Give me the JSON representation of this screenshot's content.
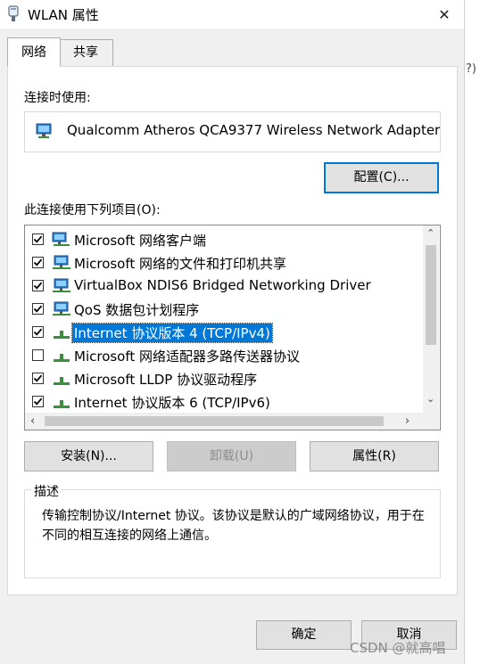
{
  "window": {
    "title": "WLAN 属性",
    "close_glyph": "✕"
  },
  "tabs": [
    {
      "label": "网络",
      "active": true
    },
    {
      "label": "共享",
      "active": false
    }
  ],
  "connect_using": {
    "label": "连接时使用:",
    "adapter_name": "Qualcomm Atheros QCA9377 Wireless Network Adapter",
    "configure_button": "配置(C)..."
  },
  "items_section": {
    "label": "此连接使用下列项目(O):",
    "items": [
      {
        "label": "Microsoft 网络客户端",
        "checked": true,
        "icon": "network-client-icon"
      },
      {
        "label": "Microsoft 网络的文件和打印机共享",
        "checked": true,
        "icon": "network-service-icon"
      },
      {
        "label": "VirtualBox NDIS6 Bridged Networking Driver",
        "checked": true,
        "icon": "network-service-icon"
      },
      {
        "label": "QoS 数据包计划程序",
        "checked": true,
        "icon": "network-service-icon"
      },
      {
        "label": "Internet 协议版本 4 (TCP/IPv4)",
        "checked": true,
        "selected": true,
        "icon": "protocol-icon"
      },
      {
        "label": "Microsoft 网络适配器多路传送器协议",
        "checked": false,
        "icon": "protocol-icon"
      },
      {
        "label": "Microsoft LLDP 协议驱动程序",
        "checked": true,
        "icon": "protocol-icon"
      },
      {
        "label": "Internet 协议版本 6 (TCP/IPv6)",
        "checked": true,
        "icon": "protocol-icon"
      }
    ]
  },
  "buttons": {
    "install": "安装(N)...",
    "uninstall": "卸载(U)",
    "properties": "属性(R)",
    "ok": "确定",
    "cancel": "取消"
  },
  "description": {
    "title": "描述",
    "text": "传输控制协议/Internet 协议。该协议是默认的广域网络协议，用于在不同的相互连接的网络上通信。"
  },
  "side_text": "?)",
  "watermark": "CSDN @就高唱",
  "colors": {
    "selection": "#0078d7",
    "focus_border": "#0078d7",
    "window_bg": "#f0f0f0"
  }
}
